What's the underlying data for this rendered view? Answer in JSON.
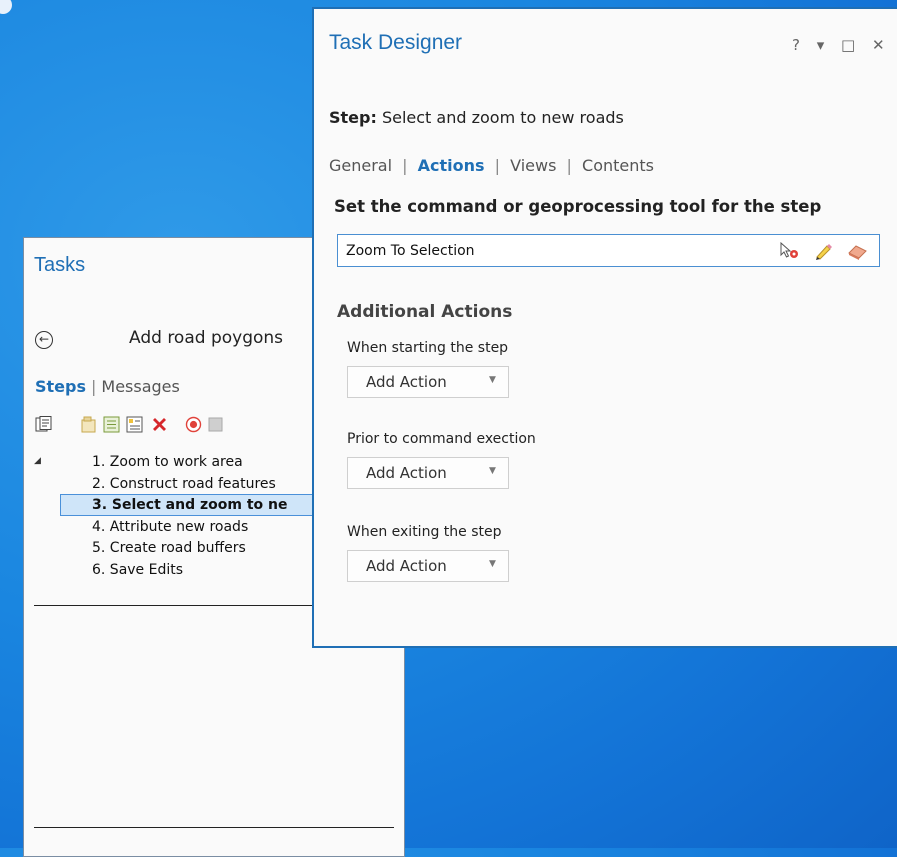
{
  "tasks_pane": {
    "title": "Tasks",
    "help": "?",
    "task_name": "Add road poygons",
    "tabs": [
      "Steps",
      "|",
      "Messages"
    ],
    "steps": [
      {
        "label": "1. Zoom to work area",
        "selected": false
      },
      {
        "label": "2. Construct road features",
        "selected": false
      },
      {
        "label": "3. Select and zoom to ne",
        "selected": true
      },
      {
        "label": "4. Attribute new roads",
        "selected": false
      },
      {
        "label": "5. Create road buffers",
        "selected": false
      },
      {
        "label": "6. Save Edits",
        "selected": false
      }
    ]
  },
  "designer": {
    "title": "Task Designer",
    "controls": "? ▾ □ ✕",
    "step_prefix": "Step:",
    "step_name": "Select and zoom to new roads",
    "tabs": {
      "general": "General",
      "actions": "Actions",
      "views": "Views",
      "contents": "Contents",
      "sep": "|"
    },
    "instruction": "Set the command or geoprocessing tool for the step",
    "command_value": "Zoom To Selection",
    "additional_actions_title": "Additional Actions",
    "sections": [
      {
        "label": "When starting the step",
        "button": "Add Action"
      },
      {
        "label": "Prior to command exection",
        "button": "Add Action"
      },
      {
        "label": "When exiting the step",
        "button": "Add Action"
      }
    ]
  },
  "colors": {
    "accent": "#1f6fb5",
    "selection": "#cfe5f9",
    "delete": "#d6262b",
    "record": "#e0423a"
  }
}
